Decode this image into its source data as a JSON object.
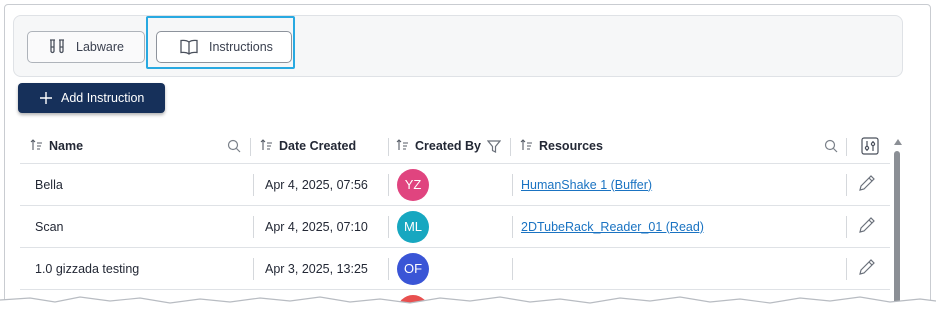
{
  "tabs": [
    {
      "label": "Labware",
      "icon": "test-tubes-icon",
      "selected": false
    },
    {
      "label": "Instructions",
      "icon": "open-book-icon",
      "selected": true
    }
  ],
  "toolbar": {
    "add_label": "Add Instruction",
    "add_icon": "plus-icon"
  },
  "table": {
    "columns": [
      {
        "label": "Name",
        "sort_icon": "sort-icon",
        "tool": "search-icon"
      },
      {
        "label": "Date Created",
        "sort_icon": "sort-icon"
      },
      {
        "label": "Created By",
        "sort_icon": "sort-icon",
        "tool": "filter-icon"
      },
      {
        "label": "Resources",
        "sort_icon": "sort-icon",
        "tool": "search-icon"
      }
    ],
    "column_settings_icon": "column-settings-icon",
    "rows": [
      {
        "name": "Bella",
        "date": "Apr 4, 2025, 07:56",
        "initials": "YZ",
        "avatar_color": "#e0447f",
        "resource": "HumanShake 1 (Buffer)",
        "action_icon": "pencil-icon"
      },
      {
        "name": "Scan",
        "date": "Apr 4, 2025, 07:10",
        "initials": "ML",
        "avatar_color": "#17a7c0",
        "resource": "2DTubeRack_Reader_01 (Read)",
        "action_icon": "pencil-icon"
      },
      {
        "name": "1.0 gizzada testing",
        "date": "Apr 3, 2025, 13:25",
        "initials": "OF",
        "avatar_color": "#3a55d6",
        "resource": "",
        "action_icon": "pencil-icon"
      }
    ]
  },
  "colors": {
    "primary_button": "#16305a",
    "focus_ring": "#28a9e1",
    "link": "#1a73c2"
  }
}
